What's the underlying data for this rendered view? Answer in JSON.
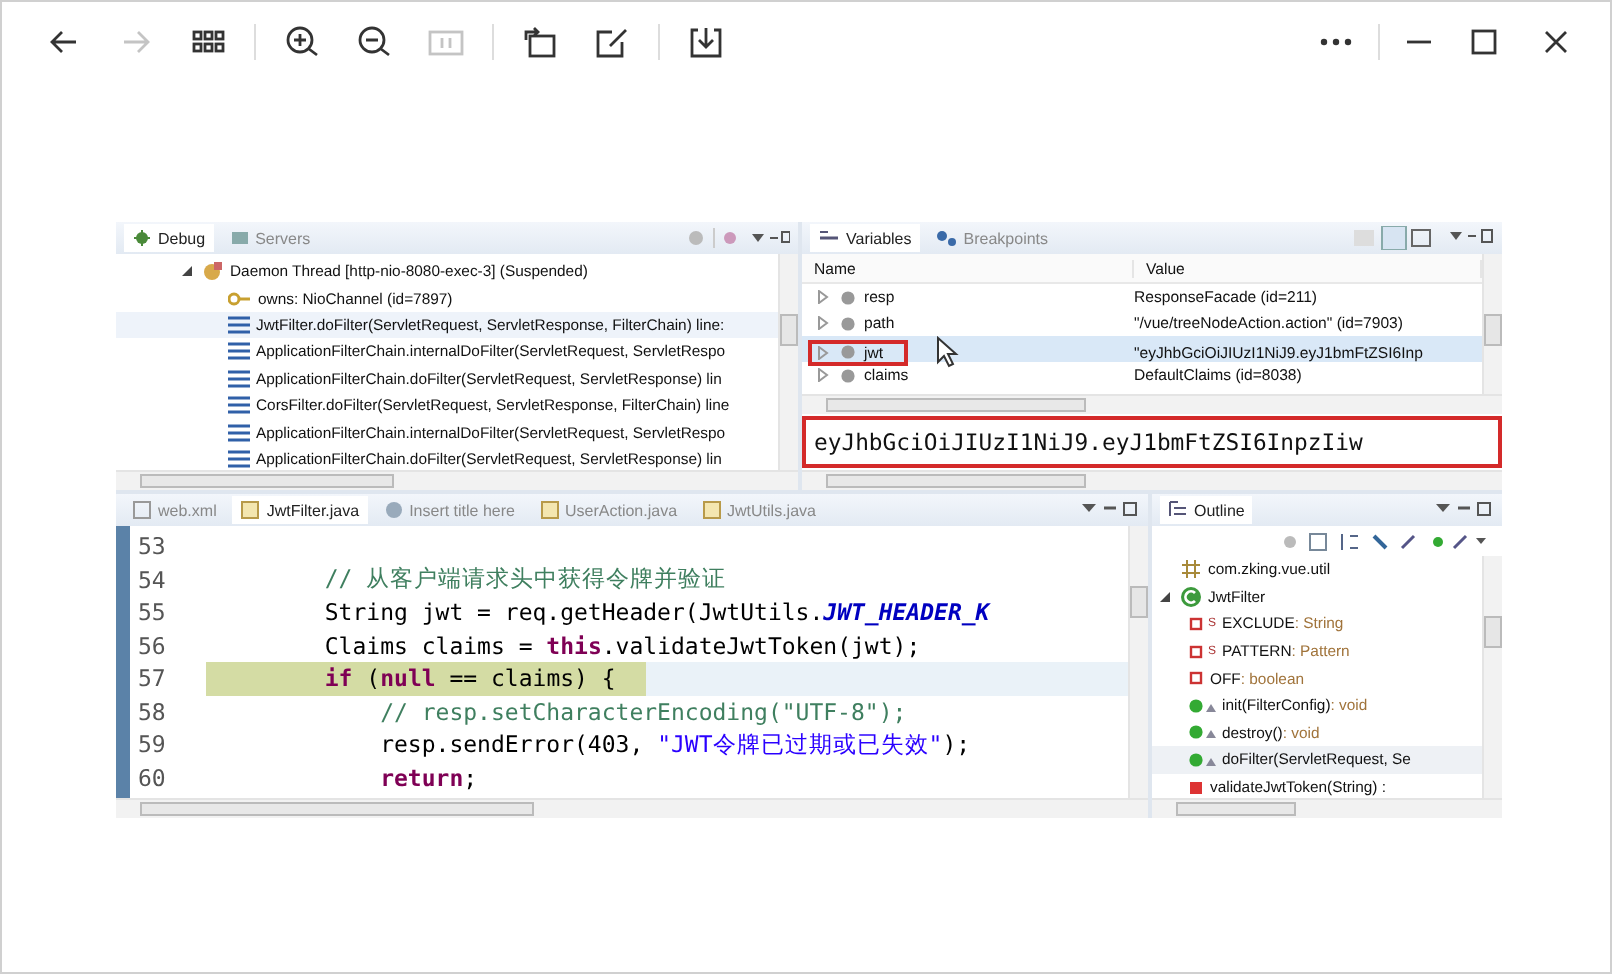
{
  "toolbar": {
    "left": [
      [
        {
          "kind": "back",
          "disabled": false
        },
        {
          "kind": "forward",
          "disabled": true
        },
        {
          "kind": "grid",
          "disabled": false
        }
      ],
      [
        {
          "kind": "zoom-in",
          "disabled": false
        },
        {
          "kind": "zoom-out",
          "disabled": false
        },
        {
          "kind": "actual-size",
          "disabled": true
        }
      ],
      [
        {
          "kind": "rotate",
          "disabled": false
        },
        {
          "kind": "edit",
          "disabled": false
        }
      ],
      [
        {
          "kind": "download",
          "disabled": false
        }
      ]
    ],
    "right": [
      [
        {
          "kind": "more",
          "disabled": false
        }
      ],
      [
        {
          "kind": "minimize",
          "disabled": false
        },
        {
          "kind": "maximize",
          "disabled": false
        },
        {
          "kind": "close",
          "disabled": false
        }
      ]
    ]
  },
  "debug": {
    "tabs": [
      {
        "label": "Debug",
        "selected": true
      },
      {
        "label": "Servers",
        "selected": false
      }
    ],
    "thread": {
      "label": "Daemon Thread [http-nio-8080-exec-3] (Suspended)",
      "expanded": true,
      "children": [
        {
          "kind": "lock",
          "label": "owns: NioChannel  (id=7897)",
          "selected": false
        },
        {
          "kind": "frame",
          "label": "JwtFilter.doFilter(ServletRequest, ServletResponse, FilterChain) line:",
          "selected": true
        },
        {
          "kind": "frame",
          "label": "ApplicationFilterChain.internalDoFilter(ServletRequest, ServletRespo",
          "selected": false
        },
        {
          "kind": "frame",
          "label": "ApplicationFilterChain.doFilter(ServletRequest, ServletResponse) lin",
          "selected": false
        },
        {
          "kind": "frame",
          "label": "CorsFilter.doFilter(ServletRequest, ServletResponse, FilterChain) line",
          "selected": false
        },
        {
          "kind": "frame",
          "label": "ApplicationFilterChain.internalDoFilter(ServletRequest, ServletRespo",
          "selected": false
        },
        {
          "kind": "frame",
          "label": "ApplicationFilterChain.doFilter(ServletRequest, ServletResponse) lin",
          "selected": false
        }
      ]
    }
  },
  "variables": {
    "tabs": [
      {
        "label": "Variables",
        "selected": true
      },
      {
        "label": "Breakpoints",
        "selected": false
      }
    ],
    "columns": [
      "Name",
      "Value"
    ],
    "rows": [
      {
        "name": "resp",
        "value": "ResponseFacade  (id=211)",
        "selected": false,
        "boxed": false
      },
      {
        "name": "path",
        "value": "\"/vue/treeNodeAction.action\" (id=7903)",
        "selected": false,
        "boxed": false
      },
      {
        "name": "jwt",
        "value": "\"eyJhbGciOiJIUzI1NiJ9.eyJ1bmFtZSI6Inp",
        "selected": true,
        "boxed": true
      },
      {
        "name": "claims",
        "value": "DefaultClaims  (id=8038)",
        "selected": false,
        "boxed": false
      }
    ],
    "detail": {
      "value": "eyJhbGciOiJIUzI1NiJ9.eyJ1bmFtZSI6InpzIiw",
      "boxed": true
    }
  },
  "editor": {
    "tabs": [
      {
        "label": "web.xml",
        "kind": "xml",
        "selected": false
      },
      {
        "label": "JwtFilter.java",
        "kind": "java",
        "selected": true
      },
      {
        "label": "Insert title here",
        "kind": "web",
        "selected": false
      },
      {
        "label": "UserAction.java",
        "kind": "java",
        "selected": false
      },
      {
        "label": "JwtUtils.java",
        "kind": "java",
        "selected": false
      }
    ],
    "lines": [
      {
        "number": "53",
        "current": false
      },
      {
        "number": "54",
        "current": false,
        "code": [
          {
            "text": "        // 从客户端请求头中获得令牌并验证",
            "kind": "comment"
          }
        ]
      },
      {
        "number": "55",
        "current": false,
        "code": [
          {
            "text": "        String jwt = req.getHeader(JwtUtils.",
            "kind": "plain"
          },
          {
            "text": "JWT_HEADER_K",
            "kind": "constant"
          }
        ]
      },
      {
        "number": "56",
        "current": false,
        "code": [
          {
            "text": "        Claims claims = ",
            "kind": "plain"
          },
          {
            "text": "this",
            "kind": "keyword"
          },
          {
            "text": ".validateJwtToken(jwt);",
            "kind": "plain"
          }
        ]
      },
      {
        "number": "57",
        "current": true,
        "code": [
          {
            "text": "        if",
            "kind": "keyword"
          },
          {
            "text": " (",
            "kind": "plain"
          },
          {
            "text": "null",
            "kind": "keyword"
          },
          {
            "text": " == claims) {",
            "kind": "plain"
          }
        ]
      },
      {
        "number": "58",
        "current": false,
        "code": [
          {
            "text": "            // resp.setCharacterEncoding(\"UTF-8\");",
            "kind": "comment"
          }
        ]
      },
      {
        "number": "59",
        "current": false,
        "code": [
          {
            "text": "            resp.sendError(403, ",
            "kind": "plain"
          },
          {
            "text": "\"JWT令牌已过期或已失效\"",
            "kind": "string"
          },
          {
            "text": ");",
            "kind": "plain"
          }
        ]
      },
      {
        "number": "60",
        "current": false,
        "code": [
          {
            "text": "            return",
            "kind": "keyword"
          },
          {
            "text": ";",
            "kind": "plain"
          }
        ]
      }
    ]
  },
  "outline": {
    "tabs": [
      {
        "label": "Outline",
        "selected": true
      }
    ],
    "items": [
      {
        "kind": "package",
        "name": "com.zking.vue.util",
        "selected": false
      },
      {
        "kind": "class",
        "name": "JwtFilter",
        "selected": false,
        "expanded": true,
        "children": [
          {
            "kind": "private-field",
            "modifier": "S",
            "name": "EXCLUDE",
            "type": ": String",
            "selected": false
          },
          {
            "kind": "private-field",
            "modifier": "S",
            "name": "PATTERN",
            "type": ": Pattern",
            "selected": false
          },
          {
            "kind": "private-field",
            "name": "OFF",
            "type": ": boolean",
            "selected": false
          },
          {
            "kind": "public-method",
            "name": "init(FilterConfig)",
            "type": ": void",
            "selected": false
          },
          {
            "kind": "public-method",
            "name": "destroy()",
            "type": ": void",
            "selected": false
          },
          {
            "kind": "public-method",
            "name": "doFilter(ServletRequest, Se",
            "selected": true
          },
          {
            "kind": "private-method",
            "name": "validateJwtToken(String) :",
            "selected": false
          }
        ]
      }
    ]
  }
}
